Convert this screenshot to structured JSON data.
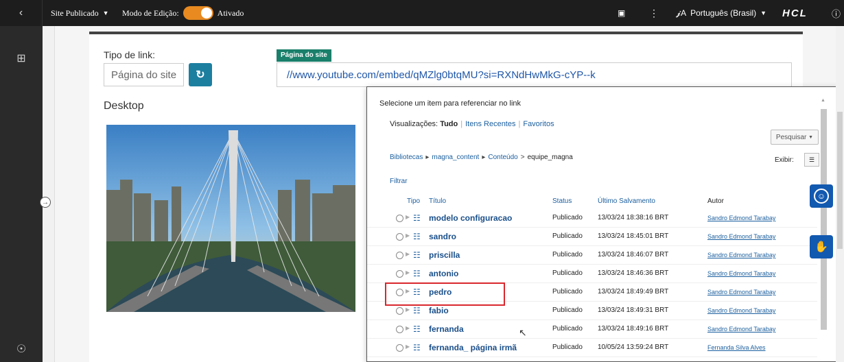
{
  "topbar": {
    "back_icon": "chevron-left-icon",
    "site_menu": "Site Publicado",
    "edit_mode_label": "Modo de Edição:",
    "edit_mode_value": "Ativado",
    "language": "Português (Brasil)",
    "brand": "HCL"
  },
  "form": {
    "link_type_label": "Tipo de link:",
    "link_type_value": "Página do site",
    "tag_label": "Página do site",
    "url_value": "//www.youtube.com/embed/qMZlg0btqMU?si=RXNdHwMkG-cYP--k",
    "desktop_label": "Desktop"
  },
  "picker": {
    "instruction": "Selecione um item para referenciar no link",
    "views_label": "Visualizações:",
    "views": [
      "Tudo",
      "Itens Recentes",
      "Favoritos"
    ],
    "search_button": "Pesquisar",
    "breadcrumb": [
      "Bibliotecas",
      "magna_content",
      "Conteúdo",
      "equipe_magna"
    ],
    "show_label": "Exibir:",
    "filter_link": "Filtrar",
    "columns": [
      "Tipo",
      "Título",
      "Status",
      "Último Salvamento",
      "Autor"
    ],
    "rows": [
      {
        "title": "modelo configuracao",
        "status": "Publicado",
        "saved": "13/03/24 18:38:16 BRT",
        "author": "Sandro Edmond Tarabay"
      },
      {
        "title": "sandro",
        "status": "Publicado",
        "saved": "13/03/24 18:45:01 BRT",
        "author": "Sandro Edmond Tarabay"
      },
      {
        "title": "priscilla",
        "status": "Publicado",
        "saved": "13/03/24 18:46:07 BRT",
        "author": "Sandro Edmond Tarabay"
      },
      {
        "title": "antonio",
        "status": "Publicado",
        "saved": "13/03/24 18:46:36 BRT",
        "author": "Sandro Edmond Tarabay"
      },
      {
        "title": "pedro",
        "status": "Publicado",
        "saved": "13/03/24 18:49:49 BRT",
        "author": "Sandro Edmond Tarabay"
      },
      {
        "title": "fabio",
        "status": "Publicado",
        "saved": "13/03/24 18:49:31 BRT",
        "author": "Sandro Edmond Tarabay"
      },
      {
        "title": "fernanda",
        "status": "Publicado",
        "saved": "13/03/24 18:49:16 BRT",
        "author": "Sandro Edmond Tarabay"
      },
      {
        "title": "fernanda_ página irmã",
        "status": "Publicado",
        "saved": "10/05/24 13:59:24 BRT",
        "author": "Fernanda Silva Alves"
      }
    ]
  },
  "colors": {
    "accent_orange": "#e88a20",
    "refresh_blue": "#1d7fa0",
    "tag_green": "#1a7f6b",
    "link_blue": "#1a5e9e",
    "highlight_red": "#d9262c",
    "a11y_blue": "#1259b0"
  }
}
